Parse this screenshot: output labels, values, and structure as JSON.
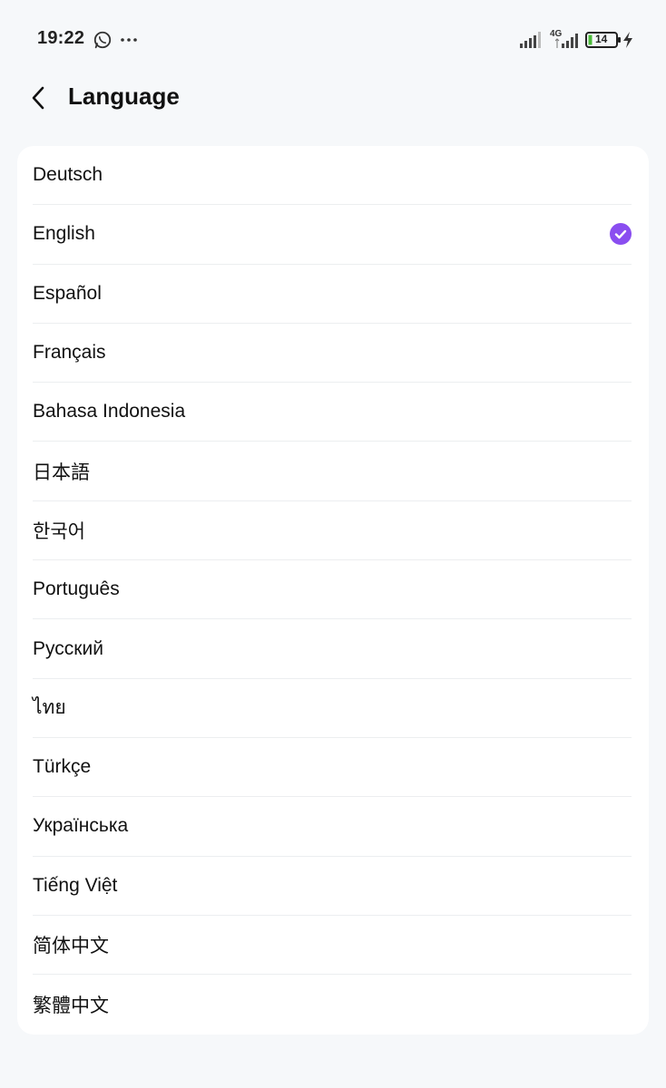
{
  "status_bar": {
    "time": "19:22",
    "network_label": "4G",
    "battery_level": "14"
  },
  "header": {
    "title": "Language"
  },
  "languages": [
    {
      "label": "Deutsch",
      "selected": false
    },
    {
      "label": "English",
      "selected": true
    },
    {
      "label": "Español",
      "selected": false
    },
    {
      "label": "Français",
      "selected": false
    },
    {
      "label": "Bahasa Indonesia",
      "selected": false
    },
    {
      "label": "日本語",
      "selected": false
    },
    {
      "label": "한국어",
      "selected": false
    },
    {
      "label": "Português",
      "selected": false
    },
    {
      "label": "Русский",
      "selected": false
    },
    {
      "label": "ไทย",
      "selected": false
    },
    {
      "label": "Türkçe",
      "selected": false
    },
    {
      "label": "Українська",
      "selected": false
    },
    {
      "label": "Tiếng Việt",
      "selected": false
    },
    {
      "label": "简体中文",
      "selected": false
    },
    {
      "label": "繁體中文",
      "selected": false
    }
  ],
  "icons": {
    "back": "chevron-left-icon",
    "selected": "check-circle-icon"
  },
  "colors": {
    "accent": "#8A4EF0",
    "background": "#F6F8FA",
    "card": "#FFFFFF"
  }
}
